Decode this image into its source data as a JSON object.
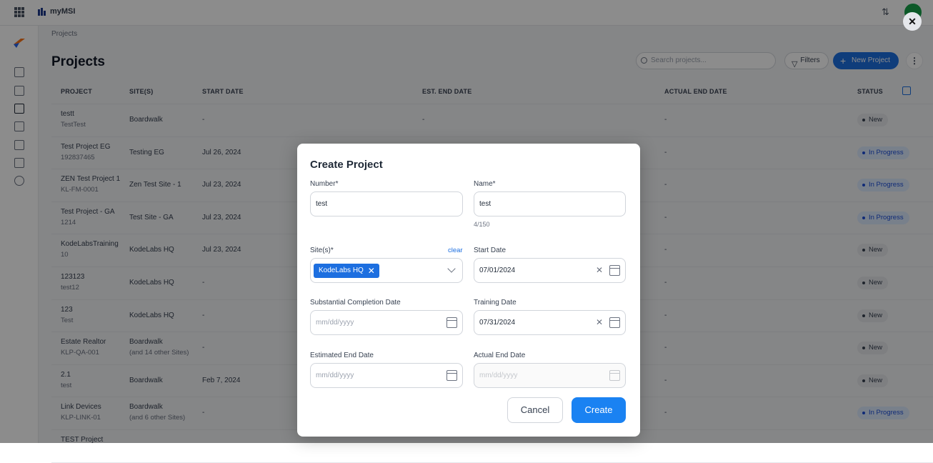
{
  "app": {
    "name": "myMSI"
  },
  "breadcrumb": "Projects",
  "page": {
    "title": "Projects"
  },
  "toolbar": {
    "search_placeholder": "Search projects...",
    "filters_label": "Filters",
    "new_label": "New Project"
  },
  "table": {
    "headers": {
      "project": "PROJECT",
      "sites": "SITE(S)",
      "start": "START DATE",
      "est_end": "EST. END DATE",
      "actual_end": "ACTUAL END DATE",
      "status": "STATUS"
    },
    "rows": [
      {
        "name": "testt",
        "number": "TestTest",
        "site": "Boardwalk",
        "site_extra": "",
        "start": "-",
        "est_end": "-",
        "actual_end": "-",
        "status": "New",
        "kind": "new"
      },
      {
        "name": "Test Project EG",
        "number": "192837465",
        "site": "Testing EG",
        "site_extra": "",
        "start": "Jul 26, 2024",
        "est_end": "",
        "actual_end": "-",
        "status": "In Progress",
        "kind": "prog"
      },
      {
        "name": "ZEN Test Project 1",
        "number": "KL-FM-0001",
        "site": "Zen Test Site - 1",
        "site_extra": "",
        "start": "Jul 23, 2024",
        "est_end": "",
        "actual_end": "-",
        "status": "In Progress",
        "kind": "prog"
      },
      {
        "name": "Test Project - GA",
        "number": "1214",
        "site": "Test Site - GA",
        "site_extra": "",
        "start": "Jul 23, 2024",
        "est_end": "",
        "actual_end": "-",
        "status": "In Progress",
        "kind": "prog"
      },
      {
        "name": "KodeLabsTraining",
        "number": "10",
        "site": "KodeLabs HQ",
        "site_extra": "",
        "start": "Jul 23, 2024",
        "est_end": "",
        "actual_end": "-",
        "status": "New",
        "kind": "new"
      },
      {
        "name": "123123",
        "number": "test12",
        "site": "KodeLabs HQ",
        "site_extra": "",
        "start": "-",
        "est_end": "",
        "actual_end": "-",
        "status": "New",
        "kind": "new"
      },
      {
        "name": "123",
        "number": "Test",
        "site": "KodeLabs HQ",
        "site_extra": "",
        "start": "-",
        "est_end": "",
        "actual_end": "-",
        "status": "New",
        "kind": "new"
      },
      {
        "name": "Estate Realtor",
        "number": "KLP-QA-001",
        "site": "Boardwalk",
        "site_extra": "(and 14 other Sites)",
        "start": "-",
        "est_end": "",
        "actual_end": "-",
        "status": "New",
        "kind": "new"
      },
      {
        "name": "2.1",
        "number": "test",
        "site": "Boardwalk",
        "site_extra": "",
        "start": "Feb 7, 2024",
        "est_end": "",
        "actual_end": "-",
        "status": "New",
        "kind": "new"
      },
      {
        "name": "Link Devices",
        "number": "KLP-LINK-01",
        "site": "Boardwalk",
        "site_extra": "(and 6 other Sites)",
        "start": "-",
        "est_end": "",
        "actual_end": "-",
        "status": "In Progress",
        "kind": "prog"
      },
      {
        "name": "TEST Project",
        "number": "",
        "site": "",
        "site_extra": "",
        "start": "",
        "est_end": "",
        "actual_end": "",
        "status": "",
        "kind": "new"
      }
    ]
  },
  "modal": {
    "title": "Create Project",
    "number": {
      "label": "Number*",
      "value": "test"
    },
    "name": {
      "label": "Name*",
      "value": "test",
      "counter": "4/150"
    },
    "sites": {
      "label": "Site(s)*",
      "clear": "clear",
      "chip": "KodeLabs HQ"
    },
    "start_date": {
      "label": "Start Date",
      "value": "07/01/2024"
    },
    "substantial": {
      "label": "Substantial Completion Date",
      "placeholder": "mm/dd/yyyy"
    },
    "training": {
      "label": "Training Date",
      "value": "07/31/2024"
    },
    "estimated_end": {
      "label": "Estimated End Date",
      "placeholder": "mm/dd/yyyy"
    },
    "actual_end": {
      "label": "Actual End Date",
      "placeholder": "mm/dd/yyyy"
    },
    "cancel": "Cancel",
    "create": "Create"
  },
  "colors": {
    "accent": "#1a82f2",
    "chip": "#1d6fe0"
  }
}
